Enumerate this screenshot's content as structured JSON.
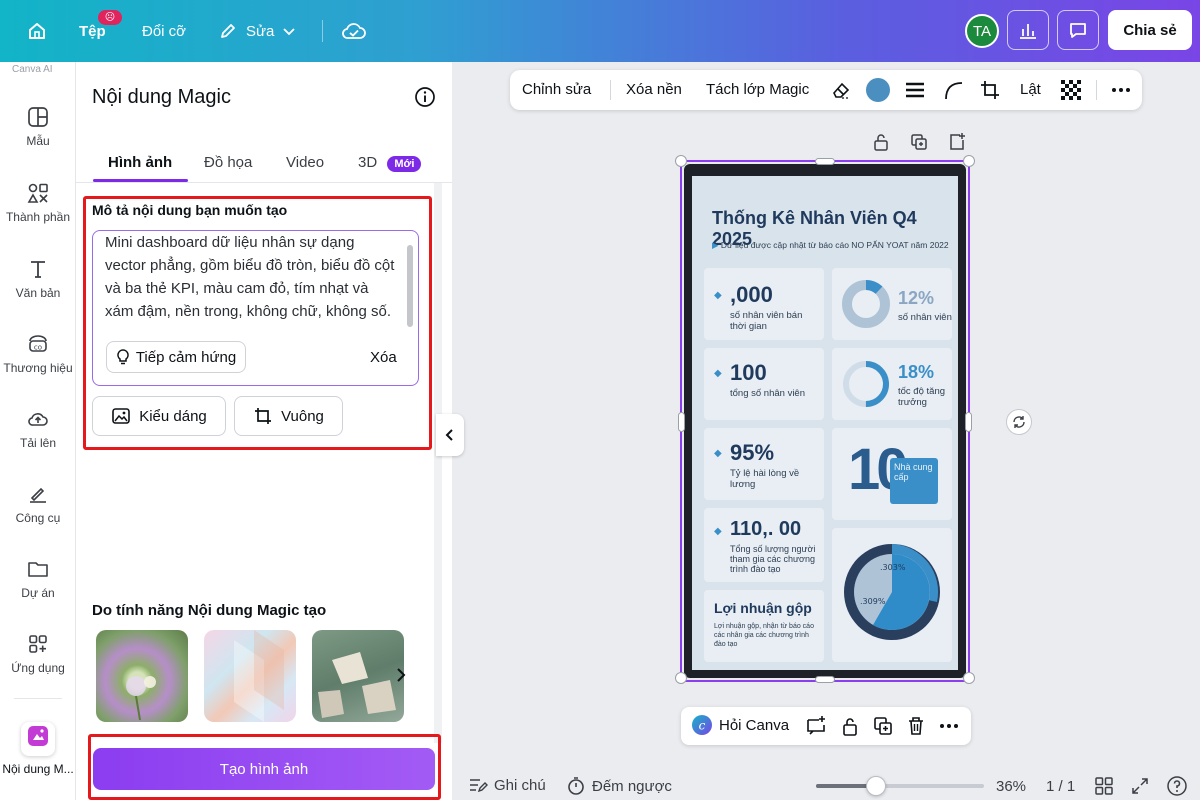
{
  "topbar": {
    "file_label": "Tệp",
    "file_badge": "☹",
    "resize_label": "Đổi cỡ",
    "edit_label": "Sửa",
    "avatar_initials": "TA",
    "share_label": "Chia sẻ"
  },
  "rail": {
    "top_label": "Canva AI",
    "items": [
      {
        "label": "Mẫu",
        "icon": "template-icon"
      },
      {
        "label": "Thành phần",
        "icon": "elements-icon"
      },
      {
        "label": "Văn bản",
        "icon": "text-icon"
      },
      {
        "label": "Thương hiệu",
        "icon": "brand-icon"
      },
      {
        "label": "Tải lên",
        "icon": "upload-icon"
      },
      {
        "label": "Công cụ",
        "icon": "tools-icon"
      },
      {
        "label": "Dự án",
        "icon": "folder-icon"
      },
      {
        "label": "Ứng dụng",
        "icon": "apps-icon"
      },
      {
        "label": "Nội dung M...",
        "icon": "magic-media-icon"
      }
    ]
  },
  "panel": {
    "title": "Nội dung Magic",
    "tabs": [
      "Hình ảnh",
      "Đồ họa",
      "Video",
      "3D"
    ],
    "new_badge": "Mới",
    "description_label": "Mô tả nội dung bạn muốn tạo",
    "prompt": "Mini dashboard dữ liệu nhân sự dạng vector phẳng, gồm biểu đồ tròn, biểu đồ cột và ba thẻ KPI, màu cam đỏ, tím nhạt và xám đậm, nền trong, không chữ, không số.",
    "inspire_label": "Tiếp cảm hứng",
    "clear_label": "Xóa",
    "style_label": "Kiểu dáng",
    "ratio_label": "Vuông",
    "made_with_label": "Do tính năng Nội dung Magic tạo",
    "generate_label": "Tạo hình ảnh"
  },
  "toolbar": {
    "edit": "Chỉnh sửa",
    "remove_bg": "Xóa nền",
    "magic_layer": "Tách lớp Magic",
    "flip": "Lật",
    "swatch_color": "#4a8fc0"
  },
  "dashboard": {
    "title": "Thống Kê Nhân Viên Q4 2025",
    "subtitle": "Dữ liệu được cập nhật từ báo cáo NO PẤN YOAT năm 2022",
    "kpis": [
      {
        "value": ",000",
        "label": "số nhân viên bán thời gian"
      },
      {
        "value": "100",
        "label": "tổng số nhân viên"
      },
      {
        "value": "95%",
        "label": "Tỷ lệ hài lòng về lương"
      },
      {
        "value": "110,. 00",
        "label": "Tổng số lượng người tham gia các chương trình đào tạo"
      }
    ],
    "rings": [
      {
        "value": "12%",
        "label": "số nhân viên",
        "fraction": 0.12
      },
      {
        "value": "18%",
        "label": "tốc độ tăng trưởng",
        "fraction": 0.5
      }
    ],
    "big_number": "10",
    "supplier_label": "Nhà cung cấp",
    "profit_title": "Lợi nhuận gộp",
    "profit_text": "Lợi nhuận gộp, nhận từ báo cáo các nhân gia các chương trình đào tạo",
    "pie_labels": [
      ".303%",
      ".309%"
    ]
  },
  "bottom_toolbar": {
    "ask_label": "Hỏi Canva"
  },
  "status": {
    "notes": "Ghi chú",
    "timer": "Đếm ngược",
    "zoom": "36%",
    "zoom_fraction": 0.36,
    "pages": "1 / 1"
  }
}
